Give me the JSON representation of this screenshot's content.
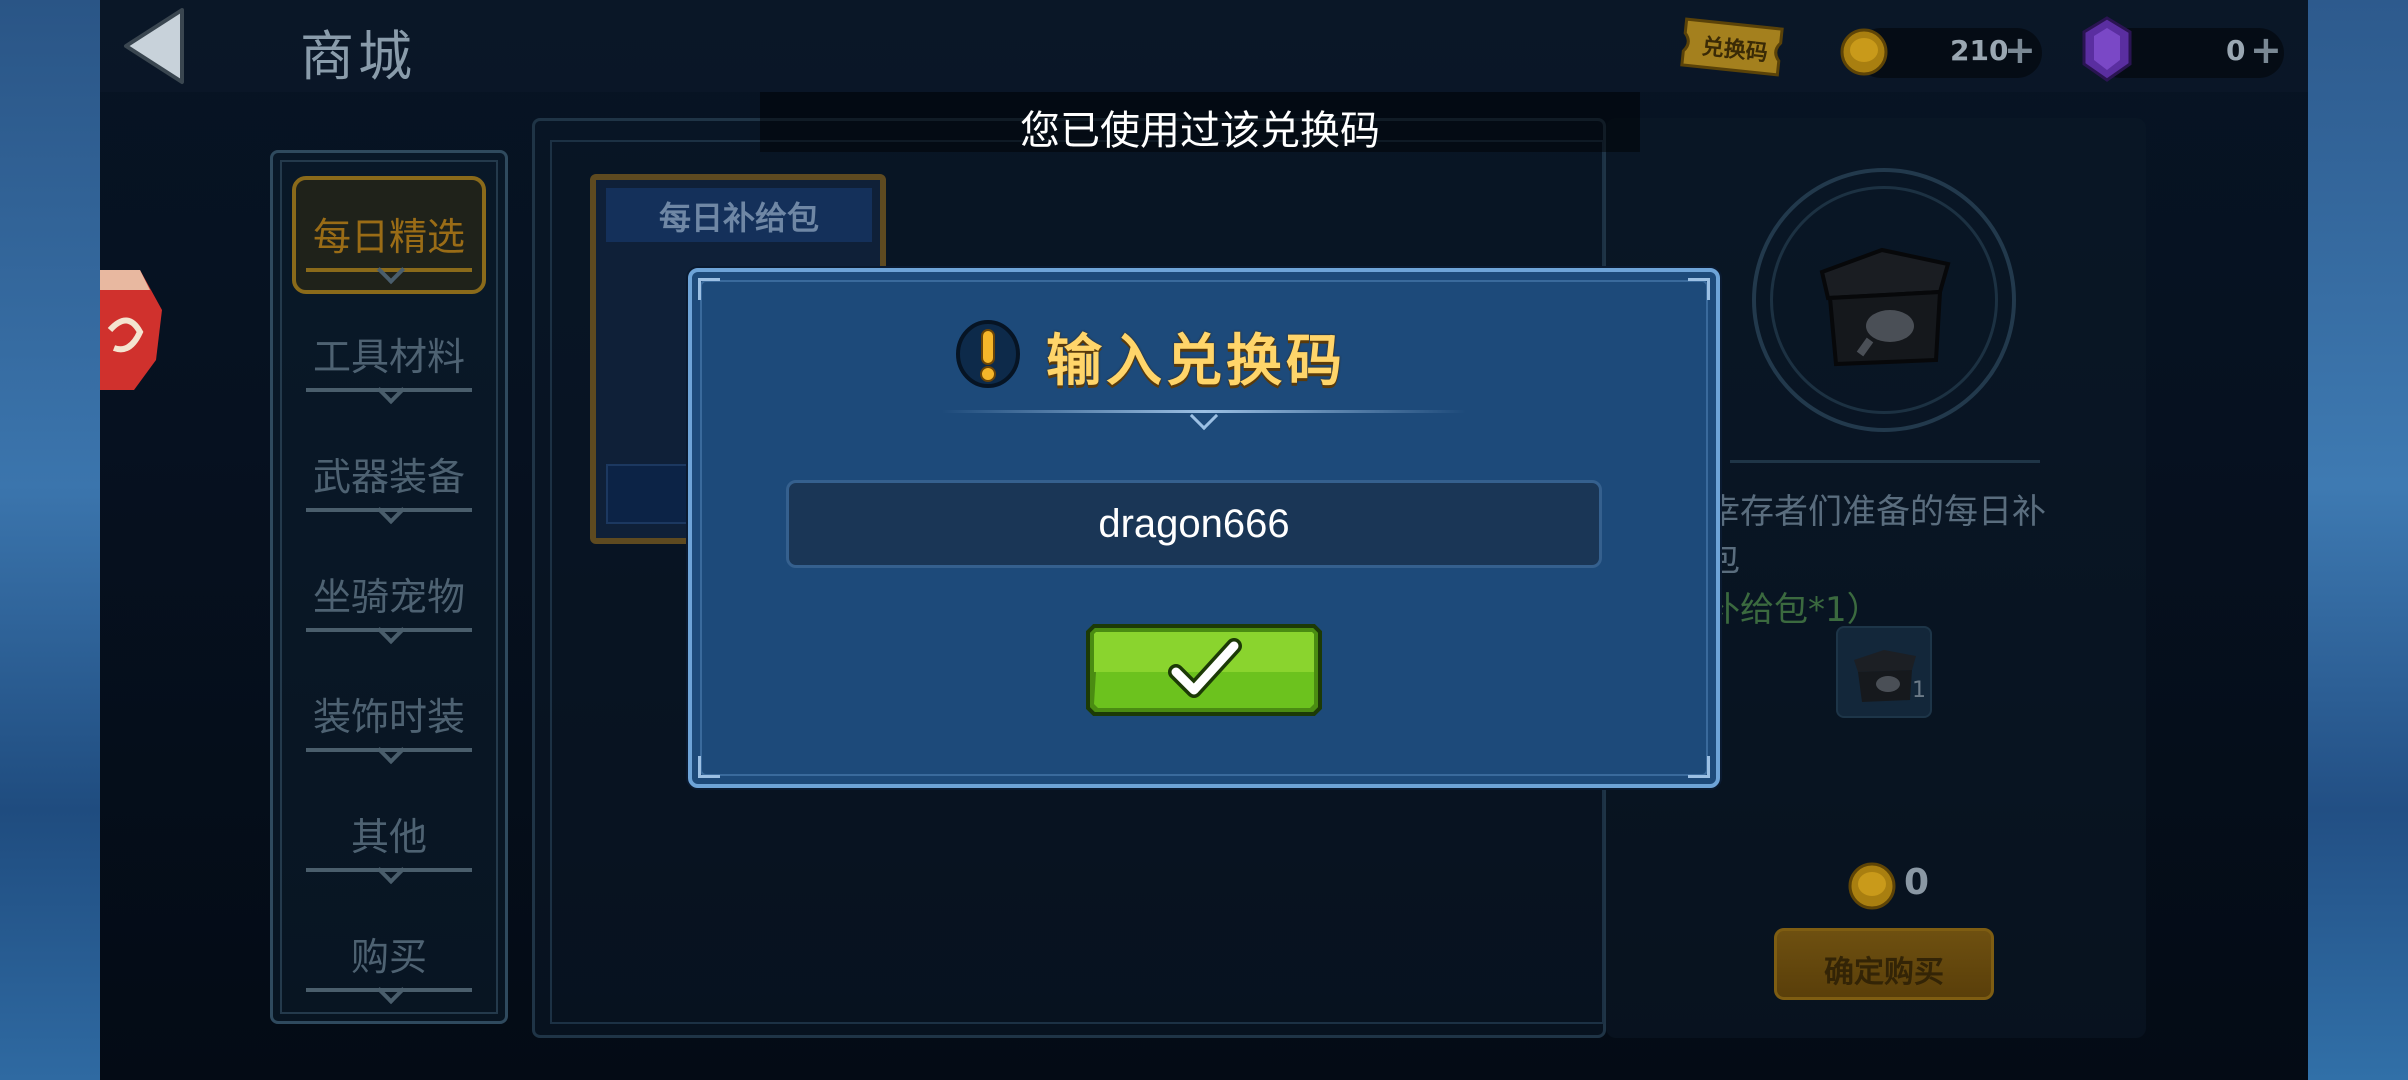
{
  "header": {
    "title": "商城",
    "coupon_label": "兑换码",
    "coins": "210",
    "gems": "0"
  },
  "toast": "您已使用过该兑换码",
  "sidebar": {
    "items": [
      {
        "label": "每日精选"
      },
      {
        "label": "工具材料"
      },
      {
        "label": "武器装备"
      },
      {
        "label": "坐骑宠物"
      },
      {
        "label": "装饰时装"
      },
      {
        "label": "其他"
      },
      {
        "label": "购买"
      }
    ]
  },
  "card": {
    "title": "每日补给包"
  },
  "detail": {
    "desc_line1": "幸存者们准备的每日补",
    "desc_line2": "包",
    "desc_line3": "补给包*1）",
    "item_count": "1",
    "price": "0",
    "buy_label": "确定购买"
  },
  "modal": {
    "title": "输入兑换码",
    "code_value": "dragon666"
  },
  "colors": {
    "modal_bg": "#1d4a7a",
    "title_gold": "#ffd56a",
    "confirm_green": "#6cc21e"
  },
  "icons": [
    "back-arrow-icon",
    "coupon-icon",
    "coin-icon",
    "gem-icon",
    "plus-icon",
    "warning-icon",
    "checkmark-icon",
    "chest-icon"
  ]
}
